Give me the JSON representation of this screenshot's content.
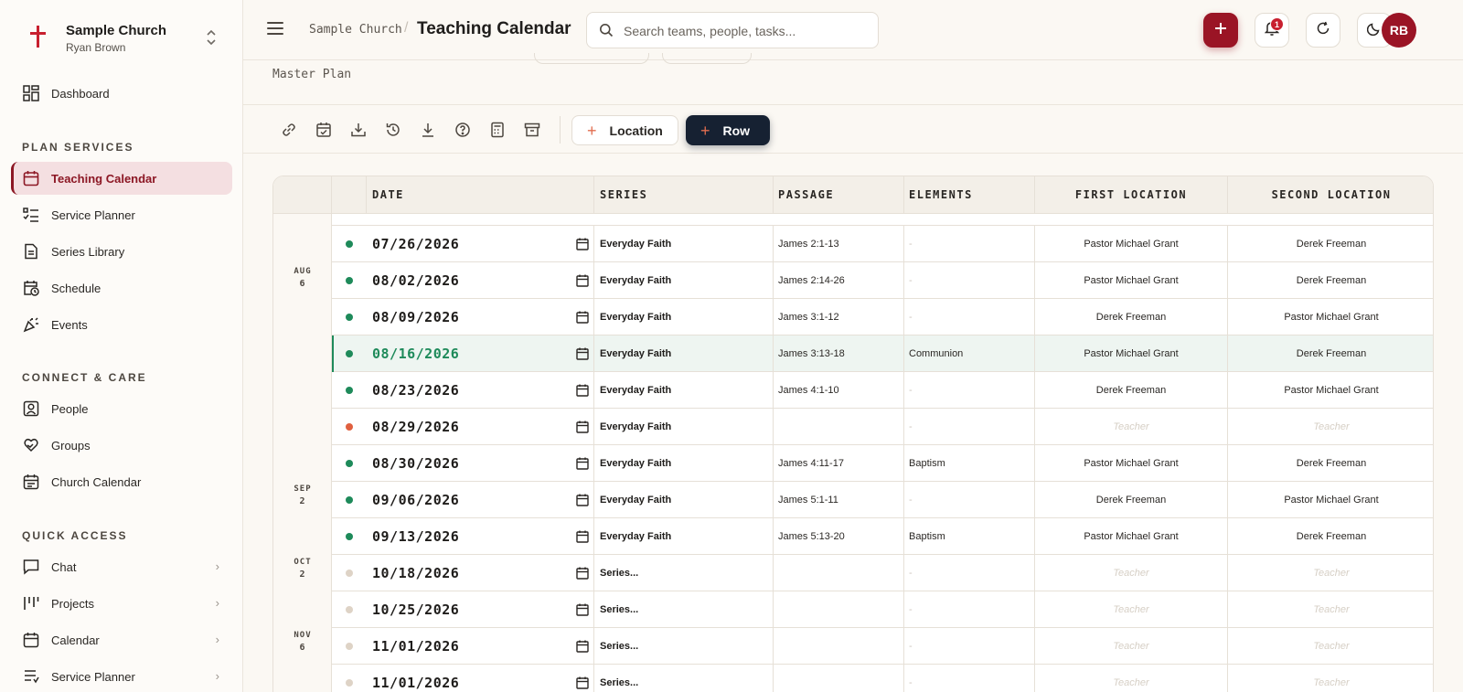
{
  "org": {
    "name": "Sample Church",
    "user": "Ryan Brown"
  },
  "sidebar": {
    "dashboard": "Dashboard",
    "plan_services_title": "PLAN SERVICES",
    "plan_services": [
      {
        "label": "Teaching Calendar",
        "icon": "calendar-icon"
      },
      {
        "label": "Service Planner",
        "icon": "checklist-icon"
      },
      {
        "label": "Series Library",
        "icon": "document-icon"
      },
      {
        "label": "Schedule",
        "icon": "calendar-clock-icon"
      },
      {
        "label": "Events",
        "icon": "party-icon"
      }
    ],
    "connect_title": "CONNECT & CARE",
    "connect": [
      {
        "label": "People",
        "icon": "person-icon"
      },
      {
        "label": "Groups",
        "icon": "heart-hands-icon"
      },
      {
        "label": "Church Calendar",
        "icon": "calendar-icon"
      }
    ],
    "quick_title": "QUICK ACCESS",
    "quick": [
      {
        "label": "Chat",
        "icon": "chat-icon"
      },
      {
        "label": "Projects",
        "icon": "kanban-icon"
      },
      {
        "label": "Calendar",
        "icon": "calendar-icon"
      },
      {
        "label": "Service Planner",
        "icon": "list-icon"
      }
    ]
  },
  "header": {
    "breadcrumb_root": "Sample Church",
    "breadcrumb_sep": "/",
    "title": "Teaching Calendar",
    "search_placeholder": "Search teams, people, tasks...",
    "notifications_count": "1",
    "avatar_initials": "RB"
  },
  "subheader": {
    "plan_label": "Master Plan"
  },
  "toolbar": {
    "location_label": "Location",
    "row_label": "Row"
  },
  "table": {
    "headers": {
      "date": "DATE",
      "series": "SERIES",
      "passage": "PASSAGE",
      "elements": "ELEMENTS",
      "first": "FIRST LOCATION",
      "second": "SECOND LOCATION"
    },
    "months": [
      {
        "name": "AUG",
        "count": "6"
      },
      {
        "name": "SEP",
        "count": "2"
      },
      {
        "name": "OCT",
        "count": "2"
      },
      {
        "name": "NOV",
        "count": "6"
      }
    ],
    "rows": [
      {
        "status": "#1e8a5a",
        "date": "07/26/2026",
        "series": "Everyday Faith",
        "passage": "James 2:1-13",
        "elements": "-",
        "first": "Pastor Michael Grant",
        "second": "Derek Freeman"
      },
      {
        "status": "#1e8a5a",
        "date": "08/02/2026",
        "series": "Everyday Faith",
        "passage": "James 2:14-26",
        "elements": "-",
        "first": "Pastor Michael Grant",
        "second": "Derek Freeman"
      },
      {
        "status": "#1e8a5a",
        "date": "08/09/2026",
        "series": "Everyday Faith",
        "passage": "James 3:1-12",
        "elements": "-",
        "first": "Derek Freeman",
        "second": "Pastor Michael Grant"
      },
      {
        "status": "#1e8a5a",
        "date": "08/16/2026",
        "series": "Everyday Faith",
        "passage": "James 3:13-18",
        "elements": "Communion",
        "first": "Pastor Michael Grant",
        "second": "Derek Freeman",
        "highlight": true
      },
      {
        "status": "#1e8a5a",
        "date": "08/23/2026",
        "series": "Everyday Faith",
        "passage": "James 4:1-10",
        "elements": "-",
        "first": "Derek Freeman",
        "second": "Pastor Michael Grant"
      },
      {
        "status": "#e0603f",
        "date": "08/29/2026",
        "series": "Everyday Faith",
        "passage": "",
        "elements": "-",
        "first": "Teacher",
        "second": "Teacher",
        "placeholder": true
      },
      {
        "status": "#1e8a5a",
        "date": "08/30/2026",
        "series": "Everyday Faith",
        "passage": "James 4:11-17",
        "elements": "Baptism",
        "first": "Pastor Michael Grant",
        "second": "Derek Freeman"
      },
      {
        "status": "#1e8a5a",
        "date": "09/06/2026",
        "series": "Everyday Faith",
        "passage": "James 5:1-11",
        "elements": "-",
        "first": "Derek Freeman",
        "second": "Pastor Michael Grant"
      },
      {
        "status": "#1e8a5a",
        "date": "09/13/2026",
        "series": "Everyday Faith",
        "passage": "James 5:13-20",
        "elements": "Baptism",
        "first": "Pastor Michael Grant",
        "second": "Derek Freeman"
      },
      {
        "status": "#ded3c6",
        "date": "10/18/2026",
        "series": "Series...",
        "passage": "",
        "elements": "-",
        "first": "Teacher",
        "second": "Teacher",
        "placeholder": true
      },
      {
        "status": "#ded3c6",
        "date": "10/25/2026",
        "series": "Series...",
        "passage": "",
        "elements": "-",
        "first": "Teacher",
        "second": "Teacher",
        "placeholder": true
      },
      {
        "status": "#ded3c6",
        "date": "11/01/2026",
        "series": "Series...",
        "passage": "",
        "elements": "-",
        "first": "Teacher",
        "second": "Teacher",
        "placeholder": true
      },
      {
        "status": "#ded3c6",
        "date": "11/01/2026",
        "series": "Series...",
        "passage": "",
        "elements": "-",
        "first": "Teacher",
        "second": "Teacher",
        "placeholder": true
      }
    ]
  },
  "colors": {
    "brand": "#9a1425",
    "active_bg": "#f4dfe1",
    "success": "#1e8a5a",
    "warning": "#e0603f",
    "dark_button": "#162132"
  }
}
